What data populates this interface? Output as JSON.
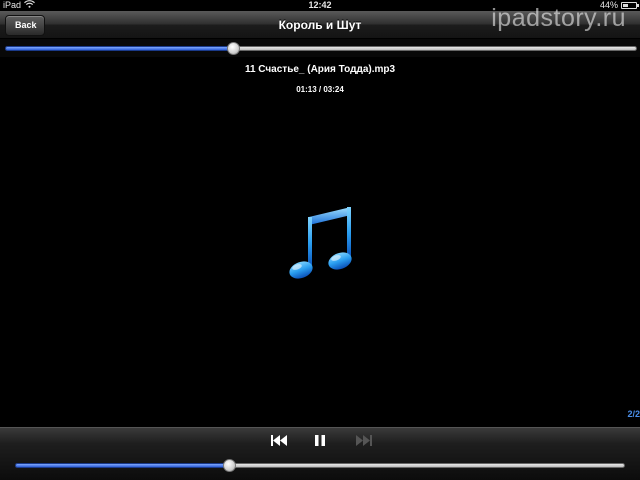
{
  "status_bar": {
    "device": "iPad",
    "time": "12:42",
    "battery_percent": "44%",
    "battery_level": 0.44
  },
  "nav": {
    "back_label": "Back",
    "title": "Король и Шут"
  },
  "watermark": "ipadstory.ru",
  "top_slider": {
    "value": 0.36
  },
  "track": {
    "title": "11 Счастье_ (Ария Тодда).mp3",
    "time": "01:13 / 03:24"
  },
  "page_counter": "2/2",
  "bottom_slider": {
    "value": 0.35
  },
  "colors": {
    "accent": "#2f5fd8",
    "note_blue": "#2a9ef0",
    "counter": "#4a8ee8"
  },
  "icons": {
    "wifi": "wifi-icon",
    "battery": "battery-icon",
    "artwork": "music-note-icon",
    "prev": "previous-track-icon",
    "pause": "pause-icon",
    "next": "next-track-icon"
  }
}
